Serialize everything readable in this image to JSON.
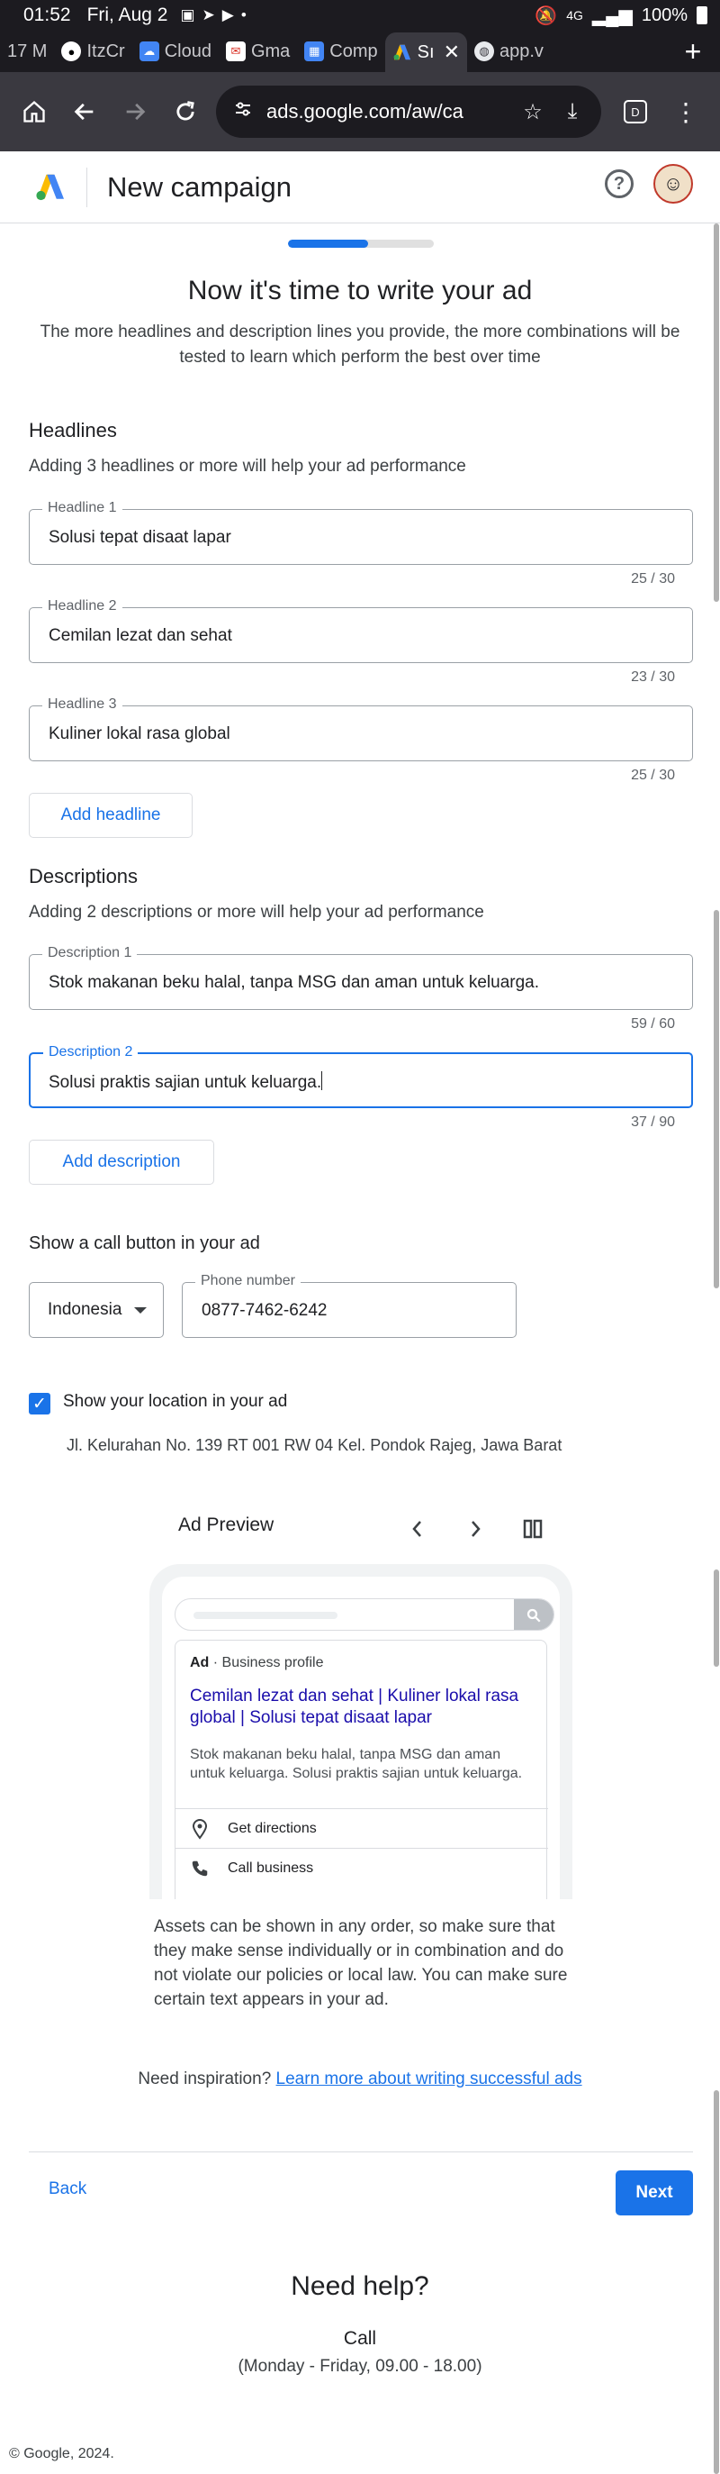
{
  "status_bar": {
    "time": "01:52",
    "date": "Fri, Aug 2",
    "signal": "4G",
    "battery": "100%"
  },
  "tabs": [
    {
      "label": "17 M",
      "icon": "generic-tab-icon"
    },
    {
      "label": "ItzCr",
      "icon": "github-icon"
    },
    {
      "label": "Cloud",
      "icon": "cloud-icon"
    },
    {
      "label": "Gma",
      "icon": "gmail-icon"
    },
    {
      "label": "Comp",
      "icon": "compose-icon"
    },
    {
      "label": "Sı",
      "icon": "google-ads-icon",
      "active": true
    },
    {
      "label": "app.v",
      "icon": "globe-icon"
    }
  ],
  "toolbar": {
    "url": "ads.google.com/aw/ca"
  },
  "header": {
    "title": "New campaign"
  },
  "progress": {
    "fraction": 0.55
  },
  "main": {
    "title": "Now it's time to write your ad",
    "intro": "The more headlines and description lines you provide, the more combinations will be tested to learn which perform the best over time"
  },
  "headlines": {
    "title": "Headlines",
    "subtitle": "Adding 3 headlines or more will help your ad performance",
    "fields": [
      {
        "label": "Headline 1",
        "value": "Solusi tepat disaat lapar",
        "counter": "25 / 30"
      },
      {
        "label": "Headline 2",
        "value": "Cemilan lezat dan sehat",
        "counter": "23 / 30"
      },
      {
        "label": "Headline 3",
        "value": "Kuliner lokal rasa global",
        "counter": "25 / 30"
      }
    ],
    "add_label": "Add headline"
  },
  "descriptions": {
    "title": "Descriptions",
    "subtitle": "Adding 2 descriptions or more will help your ad performance",
    "fields": [
      {
        "label": "Description 1",
        "value": "Stok makanan beku halal, tanpa MSG dan aman untuk keluarga.",
        "counter": "59 / 60"
      },
      {
        "label": "Description 2",
        "value": "Solusi praktis sajian untuk keluarga.",
        "counter": "37 / 90"
      }
    ],
    "add_label": "Add description"
  },
  "call": {
    "title": "Show a call button in your ad",
    "country": "Indonesia",
    "phone_label": "Phone number",
    "phone_value": "0877-7462-6242"
  },
  "location": {
    "checkbox_label": "Show your location in your ad",
    "checked": true,
    "address": "Jl. Kelurahan No. 139 RT 001 RW 04 Kel. Pondok Rajeg, Jawa Barat"
  },
  "preview": {
    "title": "Ad Preview",
    "ad_label": "Ad",
    "business_label": "Business profile",
    "ad_title": "Cemilan lezat dan sehat | Kuliner lokal rasa global | Solusi tepat disaat lapar",
    "ad_description": "Stok makanan beku halal, tanpa MSG dan aman untuk keluarga. Solusi praktis sajian untuk keluarga.",
    "directions_label": "Get directions",
    "call_label": "Call business"
  },
  "note": "Assets can be shown in any order, so make sure that they make sense individually or in combination and do not violate our policies or local law. You can make sure certain text appears in your ad.",
  "inspiration": {
    "prefix": "Need inspiration?",
    "link": "Learn more about writing successful ads"
  },
  "nav": {
    "back": "Back",
    "next": "Next"
  },
  "help": {
    "title": "Need help?",
    "call": "Call",
    "hours": "(Monday - Friday, 09.00 - 18.00)"
  },
  "footer": "© Google, 2024.",
  "colors": {
    "accent": "#1a73e8",
    "ad_title": "#1a0dab",
    "chrome_dark": "#1c1b20",
    "toolbar": "#3a3940"
  }
}
